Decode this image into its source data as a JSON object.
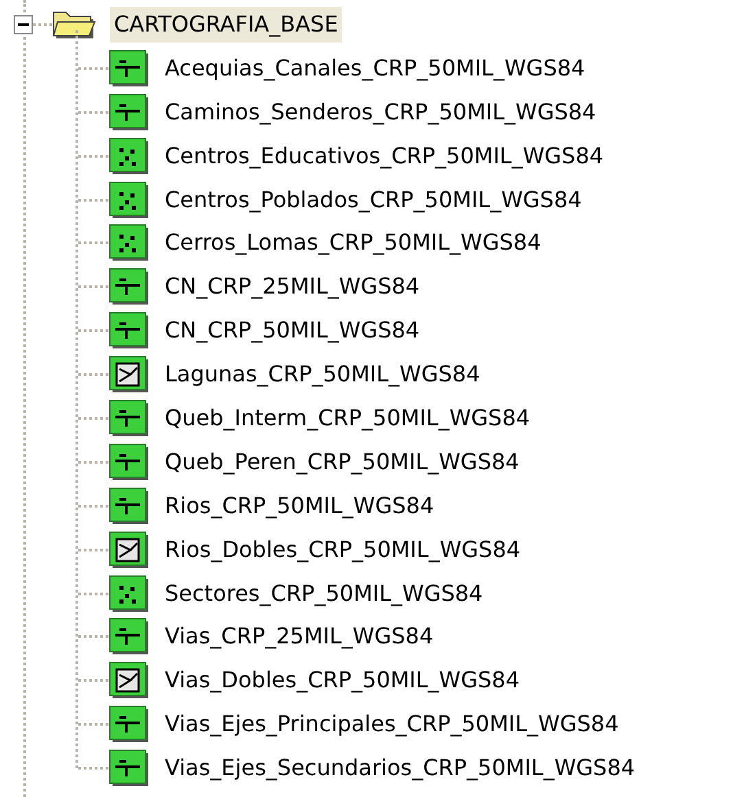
{
  "tree": {
    "label": "CARTOGRAFIA_BASE",
    "expanded": true,
    "selected": true,
    "children": [
      {
        "label": "Acequias_Canales_CRP_50MIL_WGS84",
        "kind": "line"
      },
      {
        "label": "Caminos_Senderos_CRP_50MIL_WGS84",
        "kind": "line"
      },
      {
        "label": "Centros_Educativos_CRP_50MIL_WGS84",
        "kind": "point"
      },
      {
        "label": "Centros_Poblados_CRP_50MIL_WGS84",
        "kind": "point"
      },
      {
        "label": "Cerros_Lomas_CRP_50MIL_WGS84",
        "kind": "point"
      },
      {
        "label": "CN_CRP_25MIL_WGS84",
        "kind": "line"
      },
      {
        "label": "CN_CRP_50MIL_WGS84",
        "kind": "line"
      },
      {
        "label": "Lagunas_CRP_50MIL_WGS84",
        "kind": "polygon"
      },
      {
        "label": "Queb_Interm_CRP_50MIL_WGS84",
        "kind": "line"
      },
      {
        "label": "Queb_Peren_CRP_50MIL_WGS84",
        "kind": "line"
      },
      {
        "label": "Rios_CRP_50MIL_WGS84",
        "kind": "line"
      },
      {
        "label": "Rios_Dobles_CRP_50MIL_WGS84",
        "kind": "polygon"
      },
      {
        "label": "Sectores_CRP_50MIL_WGS84",
        "kind": "point"
      },
      {
        "label": "Vias_CRP_25MIL_WGS84",
        "kind": "line"
      },
      {
        "label": "Vias_Dobles_CRP_50MIL_WGS84",
        "kind": "polygon"
      },
      {
        "label": "Vias_Ejes_Principales_CRP_50MIL_WGS84",
        "kind": "line"
      },
      {
        "label": "Vias_Ejes_Secundarios_CRP_50MIL_WGS84",
        "kind": "line"
      }
    ]
  }
}
